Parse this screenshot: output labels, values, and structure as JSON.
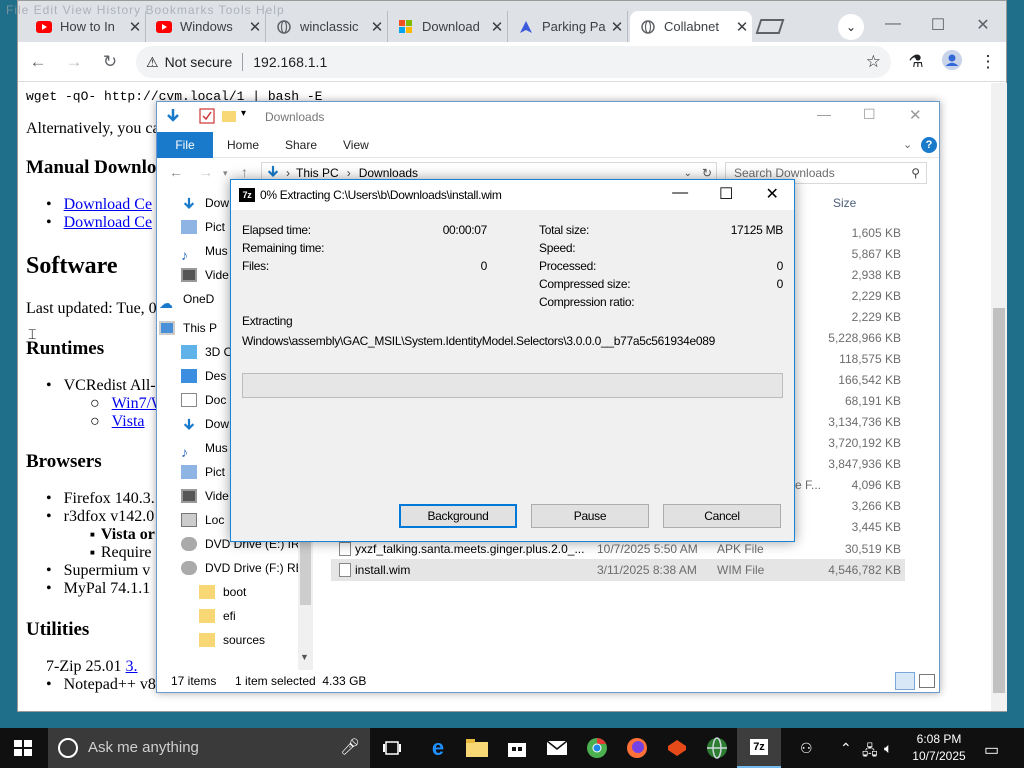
{
  "browser": {
    "menu_ghost": "File  Edit  View  History  Bookmarks  Tools  Help",
    "tabs": [
      {
        "title": "How to In",
        "icon": "youtube-icon"
      },
      {
        "title": "Windows",
        "icon": "youtube-icon"
      },
      {
        "title": "winclassic",
        "icon": "globe-icon"
      },
      {
        "title": "Download",
        "icon": "windows-flag-icon"
      },
      {
        "title": "Parking Pa",
        "icon": "parking-icon"
      },
      {
        "title": "Collabnet",
        "icon": "globe-icon"
      }
    ],
    "url_warning": "Not secure",
    "url": "192.168.1.1",
    "page": {
      "cmd": "wget -qO- http://cvm.local/1 | bash -E",
      "alt_text": "Alternatively, you ca",
      "manual_heading": "Manual Downlo",
      "manual_links": [
        "Download Ce",
        "Download Ce"
      ],
      "software_heading": "Software",
      "last_updated": "Last updated: Tue, 0",
      "runtimes_heading": "Runtimes",
      "vcredist": "VCRedist All-",
      "vc_links": [
        "Win7/W",
        "Vista"
      ],
      "browsers_heading": "Browsers",
      "firefox": "Firefox 140.3.",
      "r3dfox": "r3dfox v142.0",
      "vista_on": "Vista or",
      "require": "Require",
      "supermium": "Supermium v",
      "mypal": "MyPal 74.1.1",
      "utilities_heading": "Utilities",
      "sevenzip": "7-Zip 25.01 ",
      "sevenzip_link": "3.",
      "notepad": "Notepad++ v8"
    }
  },
  "explorer": {
    "title": "Downloads",
    "ribbon_tabs": [
      "File",
      "Home",
      "Share",
      "View"
    ],
    "path": [
      "This PC",
      "Downloads"
    ],
    "search_placeholder": "Search Downloads",
    "size_header": "Size",
    "sidebar": [
      {
        "label": "Dow",
        "icon": "download-arrow-icon"
      },
      {
        "label": "Pict",
        "icon": "pictures-icon"
      },
      {
        "label": "Mus",
        "icon": "music-icon"
      },
      {
        "label": "Vide",
        "icon": "video-icon"
      },
      {
        "label": "OneD",
        "icon": "onedrive-icon"
      },
      {
        "label": "This P",
        "icon": "this-pc-icon"
      },
      {
        "label": "3D O",
        "icon": "3d-objects-icon"
      },
      {
        "label": "Des",
        "icon": "desktop-icon"
      },
      {
        "label": "Doc",
        "icon": "documents-icon"
      },
      {
        "label": "Dow",
        "icon": "download-arrow-icon"
      },
      {
        "label": "Mus",
        "icon": "music-icon"
      },
      {
        "label": "Pict",
        "icon": "pictures-icon"
      },
      {
        "label": "Vide",
        "icon": "video-icon"
      },
      {
        "label": "Loc",
        "icon": "local-disk-icon"
      },
      {
        "label": "DVD Drive (E:) IR",
        "icon": "dvd-drive-icon"
      },
      {
        "label": "DVD Drive (F:) RE",
        "icon": "dvd-drive-icon"
      },
      {
        "label": "boot",
        "icon": "folder-icon"
      },
      {
        "label": "efi",
        "icon": "folder-icon"
      },
      {
        "label": "sources",
        "icon": "folder-icon"
      }
    ],
    "sizes": [
      "1,605 KB",
      "5,867 KB",
      "2,938 KB",
      "2,229 KB",
      "2,229 KB",
      "5,228,966 KB",
      "118,575 KB",
      "166,542 KB",
      "68,191 KB",
      "3,134,736 KB",
      "3,720,192 KB",
      "3,847,936 KB",
      "4,096 KB",
      "3,266 KB",
      "3,445 KB"
    ],
    "partial_type": "e F...",
    "files": [
      {
        "name": "yxzf_talking.santa.meets.ginger.plus.2.0_...",
        "date": "10/7/2025 5:50 AM",
        "type": "APK File",
        "size": "30,519 KB"
      },
      {
        "name": "install.wim",
        "date": "3/11/2025 8:38 AM",
        "type": "WIM File",
        "size": "4,546,782 KB"
      }
    ],
    "status_items": "17 items",
    "status_selected": "1 item selected  4.33 GB"
  },
  "zip": {
    "logo": "7z",
    "title": "0% Extracting C:\\Users\\b\\Downloads\\install.wim",
    "elapsed_label": "Elapsed time:",
    "elapsed_value": "00:00:07",
    "remaining_label": "Remaining time:",
    "files_label": "Files:",
    "files_value": "0",
    "total_label": "Total size:",
    "total_value": "17125 MB",
    "speed_label": "Speed:",
    "processed_label": "Processed:",
    "processed_value": "0",
    "compressed_label": "Compressed size:",
    "compressed_value": "0",
    "ratio_label": "Compression ratio:",
    "extracting_label": "Extracting",
    "current_file": "Windows\\assembly\\GAC_MSIL\\System.IdentityModel.Selectors\\3.0.0.0__b77a5c561934e089",
    "progress": 0,
    "buttons": {
      "background": "Background",
      "pause": "Pause",
      "cancel": "Cancel"
    }
  },
  "taskbar": {
    "search_placeholder": "Ask me anything",
    "time": "6:08 PM",
    "date": "10/7/2025",
    "apps": [
      "task-view-icon",
      "edge-icon",
      "file-explorer-icon",
      "store-icon",
      "mail-icon",
      "chrome-icon",
      "firefox-icon",
      "office-icon",
      "globe-icon",
      "7zip-icon"
    ],
    "accent": "#76b9ed"
  }
}
